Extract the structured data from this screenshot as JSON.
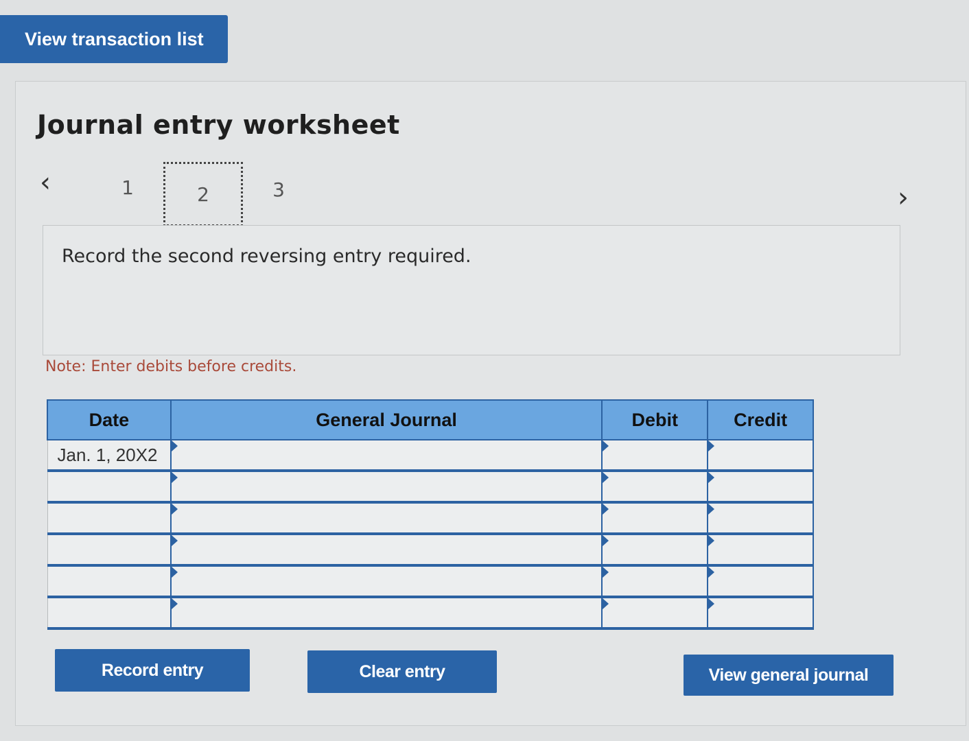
{
  "header": {
    "view_transaction_list": "View transaction list"
  },
  "worksheet": {
    "title": "Journal entry worksheet",
    "steps": [
      "1",
      "2",
      "3"
    ],
    "active_step": "2",
    "prev_icon": "chevron-left-icon",
    "next_icon": "chevron-right-icon",
    "instruction": "Record the second reversing entry required.",
    "note": "Note: Enter debits before credits."
  },
  "journal": {
    "columns": [
      "Date",
      "General Journal",
      "Debit",
      "Credit"
    ],
    "rows": [
      {
        "date": "Jan. 1, 20X2",
        "account": "",
        "debit": "",
        "credit": ""
      },
      {
        "date": "",
        "account": "",
        "debit": "",
        "credit": ""
      },
      {
        "date": "",
        "account": "",
        "debit": "",
        "credit": ""
      },
      {
        "date": "",
        "account": "",
        "debit": "",
        "credit": ""
      },
      {
        "date": "",
        "account": "",
        "debit": "",
        "credit": ""
      },
      {
        "date": "",
        "account": "",
        "debit": "",
        "credit": ""
      }
    ]
  },
  "actions": {
    "record_entry": "Record entry",
    "clear_entry": "Clear entry",
    "view_general_journal": "View general journal"
  },
  "colors": {
    "button_blue": "#2a64a8",
    "header_blue": "#6aa6e0",
    "note_red": "#a94a3a"
  }
}
